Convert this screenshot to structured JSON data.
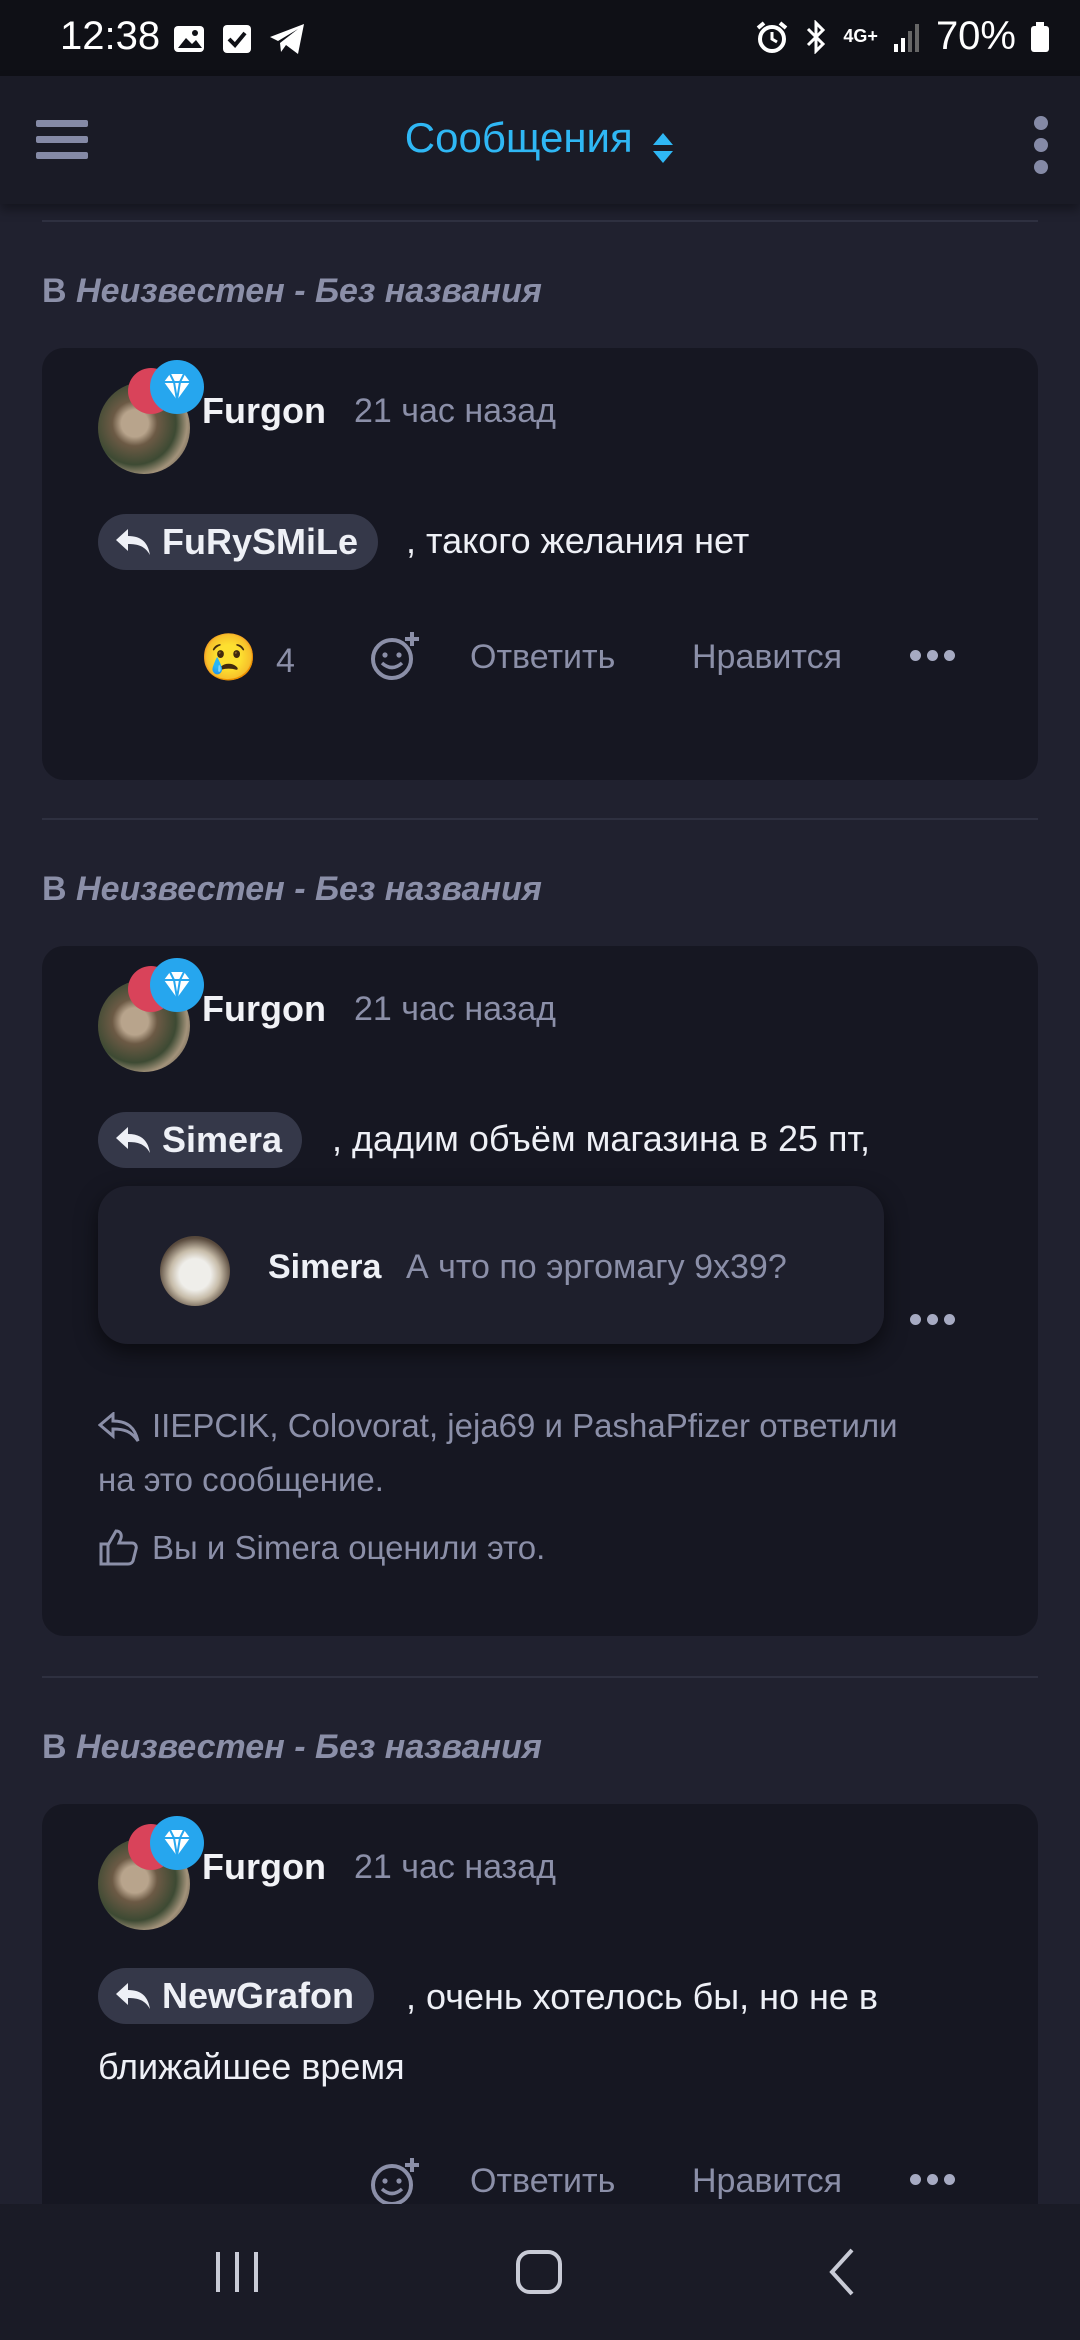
{
  "status_bar": {
    "time": "12:38",
    "network": "4G+",
    "battery": "70%"
  },
  "app_bar": {
    "title": "Сообщения"
  },
  "posts": [
    {
      "context_prefix": "В",
      "context_thread": "Неизвестен - Без названия",
      "author": "Furgon",
      "time": "21 час назад",
      "mention": "FuRySMiLe",
      "text": ", такого желания нет",
      "reaction_emoji": "😢",
      "reaction_count": "4",
      "reply_label": "Ответить",
      "like_label": "Нравится"
    },
    {
      "context_prefix": "В",
      "context_thread": "Неизвестен - Без названия",
      "author": "Furgon",
      "time": "21 час назад",
      "mention": "Simera",
      "text": ", дадим объём магазина в 25 пт,",
      "replied_by": "IIEPCIK, Colovorat, jeja69 и PashaPfizer ответили",
      "replied_by_line2": "на это сообщение.",
      "liked_by": "Вы и Simera оценили это."
    },
    {
      "context_prefix": "В",
      "context_thread": "Неизвестен - Без названия",
      "author": "Furgon",
      "time": "21 час назад",
      "mention": "NewGrafon",
      "text": ", очень хотелось бы, но не в",
      "text_line2": "ближайшее время",
      "reply_label": "Ответить",
      "like_label": "Нравится"
    }
  ],
  "quote_popup": {
    "author": "Simera",
    "text": "А что по эргомагу 9х39?"
  }
}
